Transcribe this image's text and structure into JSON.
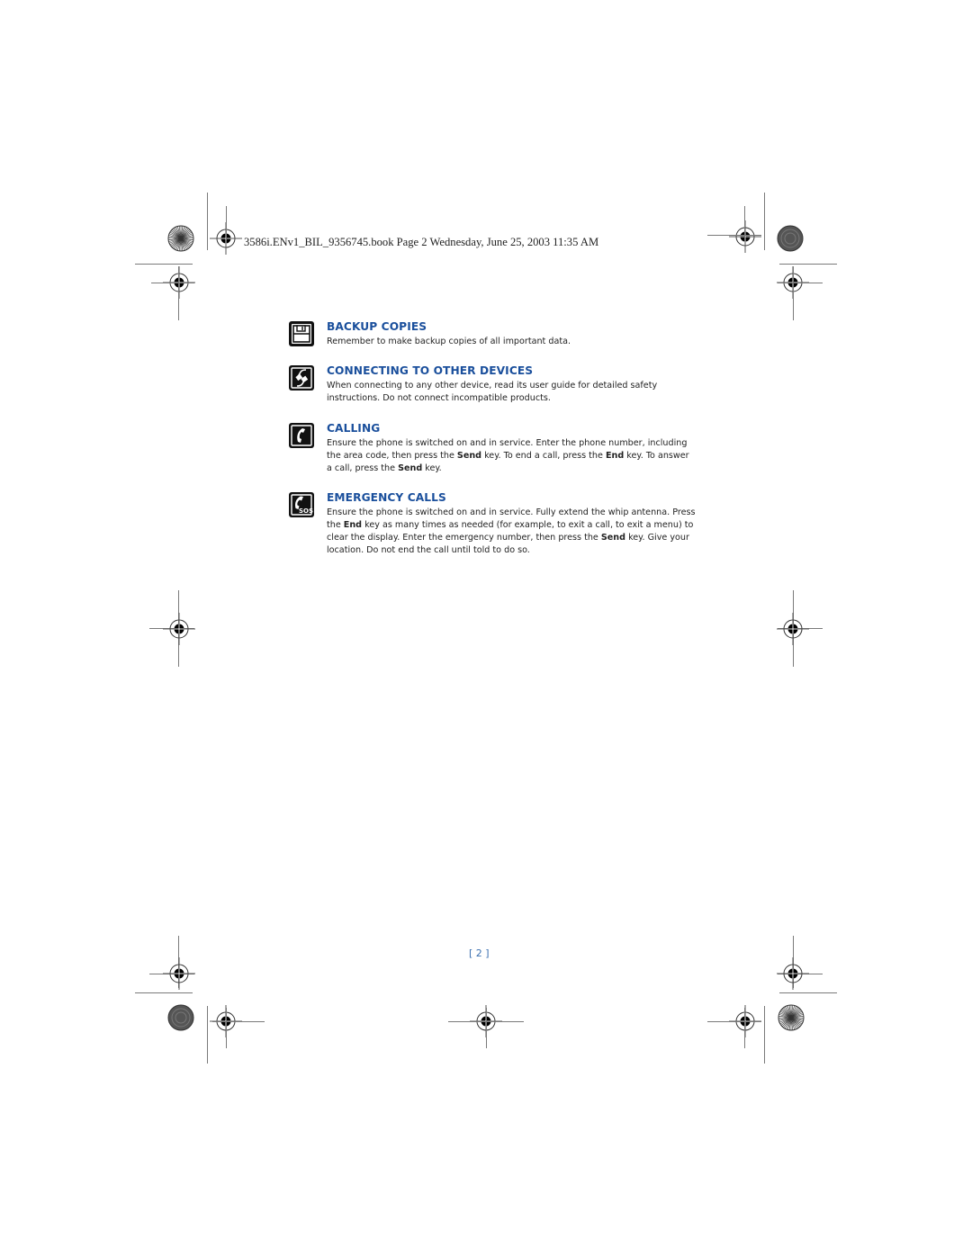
{
  "header": {
    "print_slug": "3586i.ENv1_BIL_9356745.book  Page 2  Wednesday, June 25, 2003  11:35 AM"
  },
  "accent_color": "#1a4f9c",
  "sections": [
    {
      "icon": "floppy-disk-icon",
      "title": "BACKUP COPIES",
      "body": [
        {
          "t": "Remember to make backup copies of all important data.",
          "b": false
        }
      ]
    },
    {
      "icon": "plug-connector-icon",
      "title": "CONNECTING TO OTHER DEVICES",
      "body": [
        {
          "t": "When connecting to any other device, read its user guide for detailed safety instructions. Do not connect incompatible products.",
          "b": false
        }
      ]
    },
    {
      "icon": "phone-handset-icon",
      "title": "CALLING",
      "body": [
        {
          "t": "Ensure the phone is switched on and in service. Enter the phone number, including the area code, then press the ",
          "b": false
        },
        {
          "t": "Send",
          "b": true
        },
        {
          "t": " key. To end a call, press the ",
          "b": false
        },
        {
          "t": "End",
          "b": true
        },
        {
          "t": " key. To answer a call, press the ",
          "b": false
        },
        {
          "t": "Send",
          "b": true
        },
        {
          "t": " key.",
          "b": false
        }
      ]
    },
    {
      "icon": "sos-phone-icon",
      "title": "EMERGENCY CALLS",
      "body": [
        {
          "t": "Ensure the phone is switched on and in service. Fully extend the whip antenna. Press the ",
          "b": false
        },
        {
          "t": "End",
          "b": true
        },
        {
          "t": " key as many times as needed (for example, to exit a call, to exit a menu) to clear the display. Enter the emergency number, then press the ",
          "b": false
        },
        {
          "t": "Send",
          "b": true
        },
        {
          "t": " key. Give your location. Do not end the call until told to do so.",
          "b": false
        }
      ]
    }
  ],
  "footer": {
    "page_number": "[ 2 ]"
  }
}
